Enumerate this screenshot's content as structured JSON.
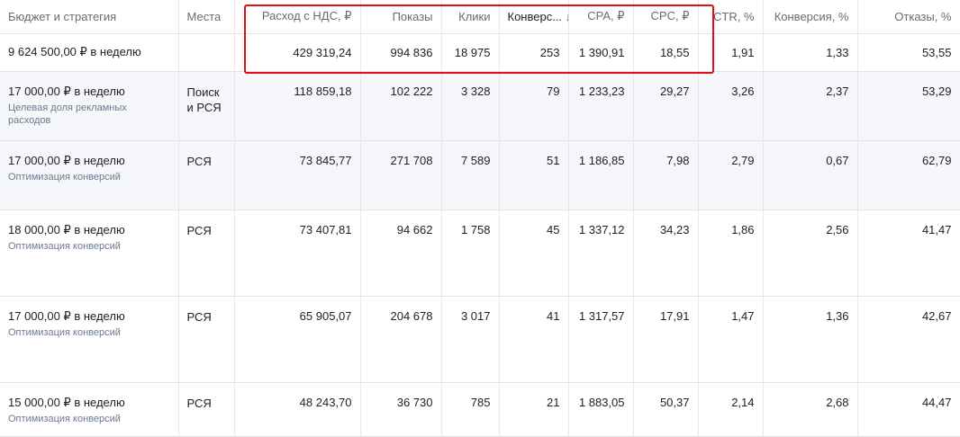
{
  "columns": [
    {
      "label": "Бюджет и стратегия"
    },
    {
      "label": "Места"
    },
    {
      "label": "Расход с НДС, ₽"
    },
    {
      "label": "Показы"
    },
    {
      "label": "Клики"
    },
    {
      "label": "Конверс..."
    },
    {
      "label": "CPA, ₽"
    },
    {
      "label": "CPC, ₽"
    },
    {
      "label": "CTR, %"
    },
    {
      "label": "Конверсия, %"
    },
    {
      "label": "Отказы, %"
    }
  ],
  "sort_icon": "arrow-down-icon",
  "total": {
    "budget": "9 624 500,00 ₽ в неделю",
    "places": "",
    "spend": "429 319,24",
    "impressions": "994 836",
    "clicks": "18 975",
    "conversions": "253",
    "cpa": "1 390,91",
    "cpc": "18,55",
    "ctr": "1,91",
    "conv_rate": "1,33",
    "bounce": "53,55"
  },
  "rows": [
    {
      "budget": "17 000,00 ₽ в неделю",
      "strategy": "Целевая доля рекламных расходов",
      "places": "Поиск и РСЯ",
      "spend": "118 859,18",
      "impressions": "102 222",
      "clicks": "3 328",
      "conversions": "79",
      "cpa": "1 233,23",
      "cpc": "29,27",
      "ctr": "3,26",
      "conv_rate": "2,37",
      "bounce": "53,29"
    },
    {
      "budget": "17 000,00 ₽ в неделю",
      "strategy": "Оптимизация конверсий",
      "places": "РСЯ",
      "spend": "73 845,77",
      "impressions": "271 708",
      "clicks": "7 589",
      "conversions": "51",
      "cpa": "1 186,85",
      "cpc": "7,98",
      "ctr": "2,79",
      "conv_rate": "0,67",
      "bounce": "62,79"
    },
    {
      "budget": "18 000,00 ₽ в неделю",
      "strategy": "Оптимизация конверсий",
      "places": "РСЯ",
      "spend": "73 407,81",
      "impressions": "94 662",
      "clicks": "1 758",
      "conversions": "45",
      "cpa": "1 337,12",
      "cpc": "34,23",
      "ctr": "1,86",
      "conv_rate": "2,56",
      "bounce": "41,47"
    },
    {
      "budget": "17 000,00 ₽ в неделю",
      "strategy": "Оптимизация конверсий",
      "places": "РСЯ",
      "spend": "65 905,07",
      "impressions": "204 678",
      "clicks": "3 017",
      "conversions": "41",
      "cpa": "1 317,57",
      "cpc": "17,91",
      "ctr": "1,47",
      "conv_rate": "1,36",
      "bounce": "42,67"
    },
    {
      "budget": "15 000,00 ₽ в неделю",
      "strategy": "Оптимизация конверсий",
      "places": "РСЯ",
      "spend": "48 243,70",
      "impressions": "36 730",
      "clicks": "785",
      "conversions": "21",
      "cpa": "1 883,05",
      "cpc": "50,37",
      "ctr": "2,14",
      "conv_rate": "2,68",
      "bounce": "44,47"
    }
  ],
  "highlight_color": "#e3101c"
}
